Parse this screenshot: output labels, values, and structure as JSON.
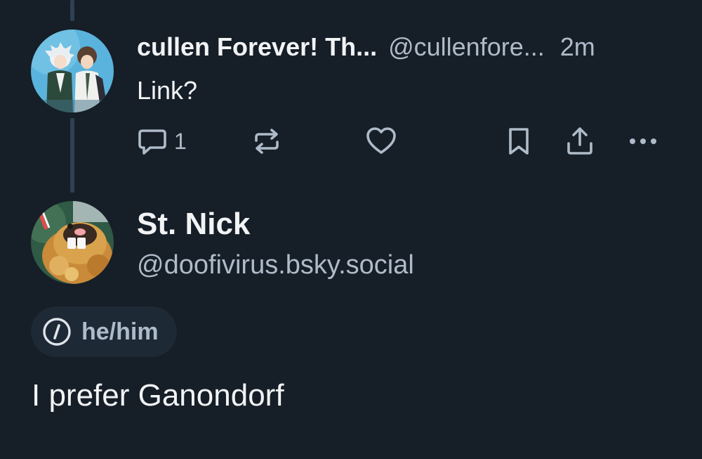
{
  "reply": {
    "author_name": "cullen Forever! Th...",
    "author_handle": "@cullenfore...",
    "time": "2m",
    "text": "Link?",
    "reply_count": "1",
    "avatar": "anime-characters-avatar"
  },
  "actions": {
    "reply_icon": "speech-bubble-icon",
    "repost_icon": "repost-icon",
    "like_icon": "heart-icon",
    "bookmark_icon": "bookmark-icon",
    "share_icon": "share-upload-icon",
    "more_icon": "ellipsis-icon"
  },
  "profile": {
    "name": "St. Nick",
    "handle": "@doofivirus.bsky.social",
    "pronouns": "he/him",
    "avatar": "bidoof-avatar"
  },
  "post": {
    "text": "I prefer Ganondorf"
  },
  "colors": {
    "background": "#161e27",
    "primary_text": "#f1f3f5",
    "secondary_text": "#aebbc9",
    "thread_line": "#2e4052",
    "pill_background": "#1e2936"
  }
}
